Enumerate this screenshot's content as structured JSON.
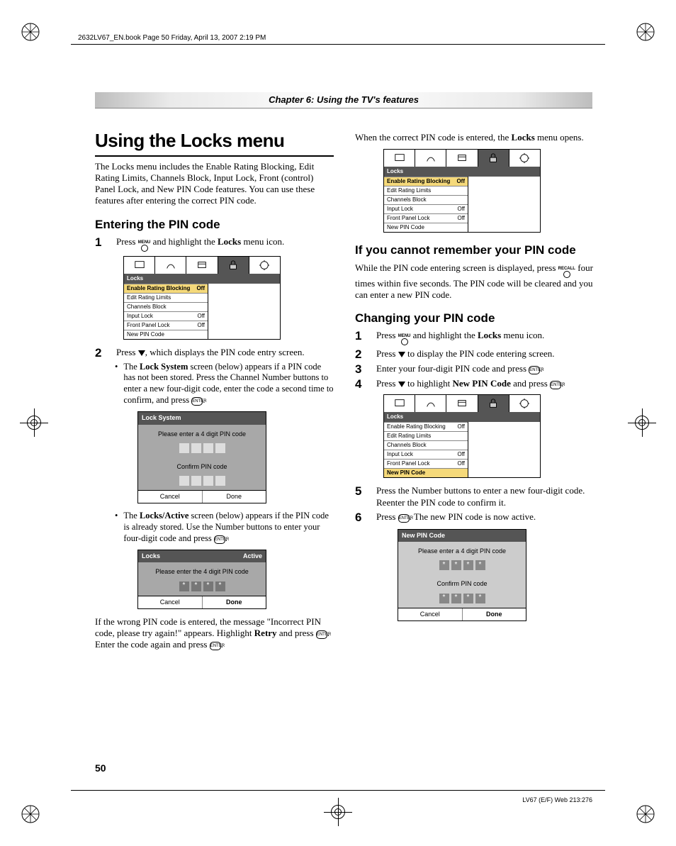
{
  "bookinfo": "2632LV67_EN.book  Page 50  Friday, April 13, 2007  2:19 PM",
  "chapter": "Chapter 6: Using the TV's features",
  "h1": "Using the Locks menu",
  "intro": "The Locks menu includes the Enable Rating Blocking, Edit Rating Limits, Channels Block, Input Lock, Front (control) Panel Lock, and New PIN Code features. You can use these features after entering the correct PIN code.",
  "h2_enter": "Entering the PIN code",
  "steps_enter": {
    "s1a": "Press ",
    "s1b": " and highlight the ",
    "s1c": " menu icon.",
    "s1_bold": "Locks",
    "s2": "Press ",
    "s2b": ", which displays the PIN code entry screen.",
    "b1a": "The ",
    "b1bold": "Lock System",
    "b1b": " screen (below) appears if a PIN code has not been stored. Press the Channel Number buttons to enter a new four-digit code, enter the code a second time to confirm, and press ",
    "b2a": "The ",
    "b2bold": "Locks/Active",
    "b2b": " screen (below) appears if the PIN code is already stored. Use the Number buttons to enter your four-digit code and press "
  },
  "wrongpin_a": "If the wrong PIN code is entered, the message \"Incorrect PIN code, please try again!\" appears. Highlight ",
  "wrongpin_bold": "Retry",
  "wrongpin_b": " and press ",
  "wrongpin_c": ". Enter the code again and press ",
  "col2_top_a": "When the correct PIN code is entered, the ",
  "col2_top_bold": "Locks",
  "col2_top_b": " menu opens.",
  "h2_forgot": "If you cannot remember your PIN code",
  "forgot_a": "While the PIN code entering screen is displayed, press ",
  "forgot_b": " four times within five seconds. The PIN code will be cleared and you can enter a new PIN code.",
  "h2_change": "Changing your PIN code",
  "steps_change": {
    "s1a": "Press ",
    "s1b": " and highlight the ",
    "s1bold": "Locks",
    "s1c": " menu icon.",
    "s2a": "Press ",
    "s2b": " to display the PIN code entering screen.",
    "s3a": "Enter your four-digit PIN code and press ",
    "s4a": "Press ",
    "s4b": " to highlight ",
    "s4bold": "New PIN Code",
    "s4c": " and press ",
    "s5": "Press the Number buttons to enter a new four-digit code. Reenter the PIN code to confirm it.",
    "s6a": "Press ",
    "s6b": ". The new PIN code is now active."
  },
  "btn_menu": "MENU",
  "btn_recall": "RECALL",
  "btn_enter": "ENTER",
  "osd": {
    "hdr": "Locks",
    "rows_a": [
      {
        "l": "Enable Rating Blocking",
        "v": "Off",
        "hl": true
      },
      {
        "l": "Edit Rating Limits",
        "v": ""
      },
      {
        "l": "Channels Block",
        "v": ""
      },
      {
        "l": "Input Lock",
        "v": "Off"
      },
      {
        "l": "Front Panel Lock",
        "v": "Off"
      },
      {
        "l": "New PIN Code",
        "v": ""
      }
    ],
    "rows_c": [
      {
        "l": "Enable Rating Blocking",
        "v": "Off"
      },
      {
        "l": "Edit Rating Limits",
        "v": ""
      },
      {
        "l": "Channels Block",
        "v": ""
      },
      {
        "l": "Input Lock",
        "v": "Off"
      },
      {
        "l": "Front Panel Lock",
        "v": "Off"
      },
      {
        "l": "New PIN Code",
        "v": "",
        "hl": true
      }
    ]
  },
  "dlg_locksystem": {
    "title": "Lock System",
    "msg": "Please enter a 4 digit PIN code",
    "confirm": "Confirm PIN code",
    "cancel": "Cancel",
    "done": "Done"
  },
  "dlg_active": {
    "title": "Locks",
    "title_r": "Active",
    "msg": "Please enter the 4 digit PIN code",
    "cancel": "Cancel",
    "done": "Done"
  },
  "dlg_newpin": {
    "title": "New PIN Code",
    "msg": "Please enter a 4 digit PIN code",
    "confirm": "Confirm PIN code",
    "cancel": "Cancel",
    "done": "Done"
  },
  "pagenum": "50",
  "footer": "LV67 (E/F) Web 213:276"
}
